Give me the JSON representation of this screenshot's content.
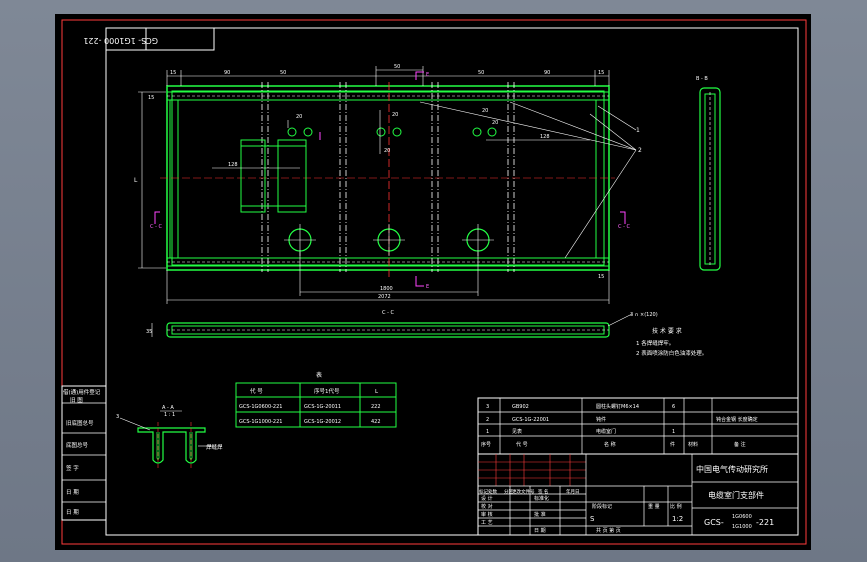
{
  "drawing": {
    "stamp_top": "GCS- 1G1000 -221",
    "stamp_top_sub": "1G1000",
    "dims_top": [
      "15",
      "90",
      "50",
      "90",
      "15",
      "50"
    ],
    "dims_misc": [
      "20",
      "20",
      "20",
      "20",
      "20",
      "8",
      "128",
      "128"
    ],
    "dim_1800": "1800",
    "dim_2072": "2072",
    "dim_L": "L",
    "dim_35": "35",
    "dim_30": "30",
    "dim_20b": "20",
    "section_marker": "E",
    "view_label_bb": "B - B",
    "view_label_cc": "C - C",
    "view_label_aa": "A - A",
    "view_scale_aa": "1 : 1",
    "callout_1": "1",
    "callout_2": "2",
    "callout_3": "3",
    "weld_note": "3 ∩ ×(120)",
    "weld_label": "焊缝焊",
    "tech_title": "技 术 要 求",
    "tech_line1": "1 各焊缝焊牢。",
    "tech_line2": "2 表面喷涂防白色油漆处理。"
  },
  "variant_table": {
    "title": "表",
    "headers": [
      "代       号",
      "序号1代号",
      "L"
    ],
    "rows": [
      [
        "GCS-1G0600-221",
        "GCS-1G-20011",
        "222"
      ],
      [
        "GCS-1G1000-221",
        "GCS-1G-20012",
        "422"
      ]
    ]
  },
  "parts_list": {
    "rows": [
      [
        "3",
        "GB902",
        "圆柱头螺钉M6×14",
        "6",
        ""
      ],
      [
        "2",
        "GCS-1G-22001",
        "钝件",
        "",
        "钝合金钢 长度确定"
      ],
      [
        "1",
        "见表",
        "电缆室门",
        "1",
        ""
      ]
    ],
    "header": [
      "序号",
      "代       号",
      "名       称",
      "件",
      "材料",
      "备       注"
    ]
  },
  "title_block": {
    "institute": "中国电气传动研究所",
    "part_name": "电缆室门支部件",
    "code_main": "GCS-",
    "code_sub1": "1G0600",
    "code_sub2": "1G1000",
    "code_suffix": "-221",
    "marks": "S",
    "scale": "1:2",
    "sheet_info": "共    页  第    页",
    "roles": [
      "设 计",
      "校 对",
      "审 核",
      "工 艺"
    ],
    "labels": [
      "标记",
      "处数",
      "分区",
      "更改文件号",
      "签 名",
      "年月日"
    ],
    "std_label": "标准化",
    "approve_label": "批 准",
    "date_label": "日 期",
    "stage_label": "阶段标记",
    "weight_label": "重 量",
    "scale_label": "比 例"
  },
  "side_block": {
    "items": [
      "借(通)用件登记",
      "旧底图总号",
      "底图总号",
      "签    字",
      "日    期"
    ],
    "header": "旧 图"
  }
}
